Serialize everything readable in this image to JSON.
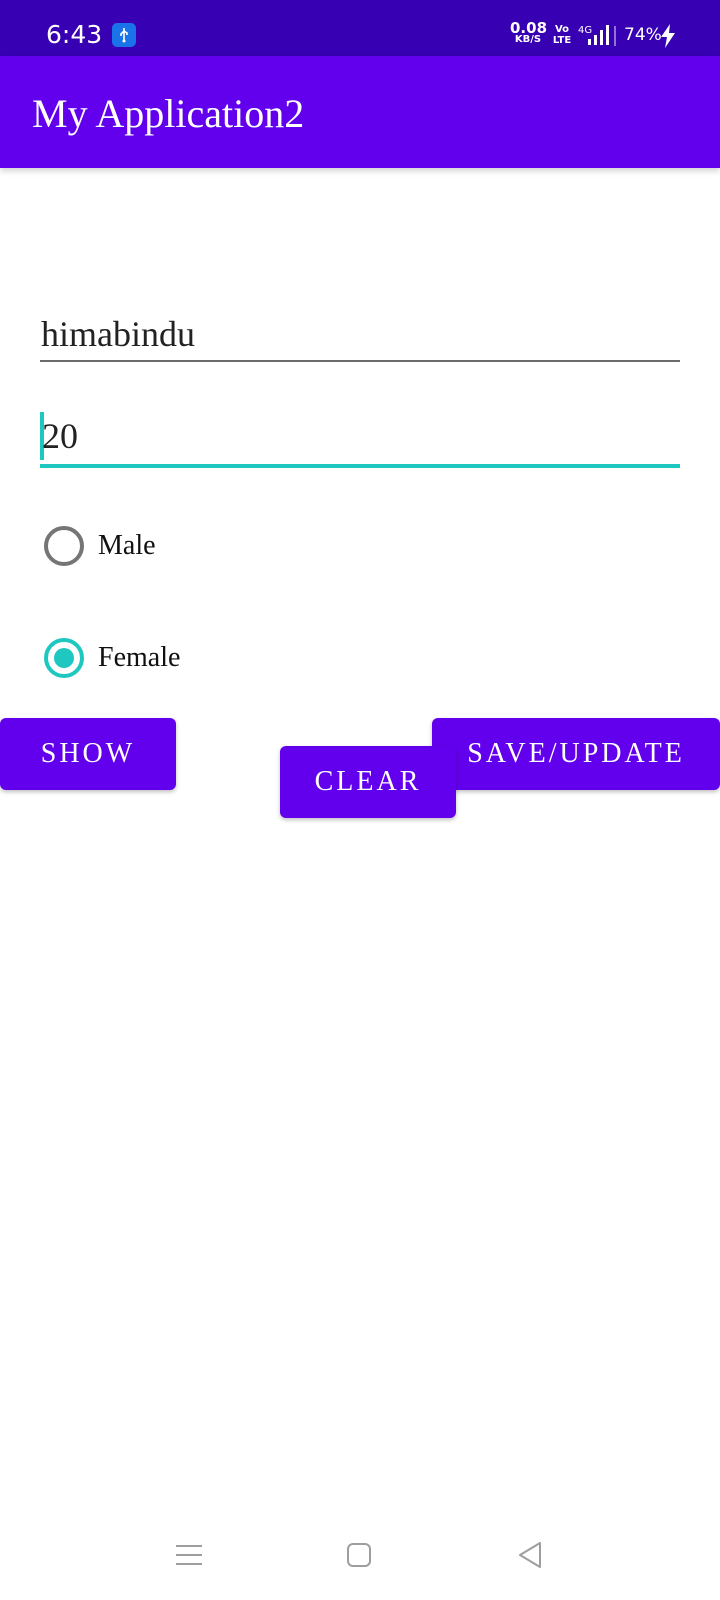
{
  "status_bar": {
    "time": "6:43",
    "net_speed_value": "0.08",
    "net_speed_unit": "KB/S",
    "volte_top": "Vo",
    "volte_bottom": "LTE",
    "network_type": "4G",
    "battery": "74%",
    "icons": [
      "usb-icon",
      "signal-icon",
      "charging-icon"
    ]
  },
  "app_bar": {
    "title": "My Application2",
    "color": "#6200EE"
  },
  "form": {
    "name_value": "himabindu",
    "age_value": "20",
    "gender_options": [
      {
        "label": "Male",
        "checked": false
      },
      {
        "label": "Female",
        "checked": true
      }
    ]
  },
  "buttons": {
    "show": "SHOW",
    "save_update": "SAVE/UPDATE",
    "clear": "CLEAR"
  },
  "nav_bar": {
    "icons": [
      "menu-icon",
      "home-icon",
      "back-icon"
    ]
  },
  "colors": {
    "status_bar": "#3700B3",
    "primary": "#6200EE",
    "accent": "#1EC8C0"
  }
}
